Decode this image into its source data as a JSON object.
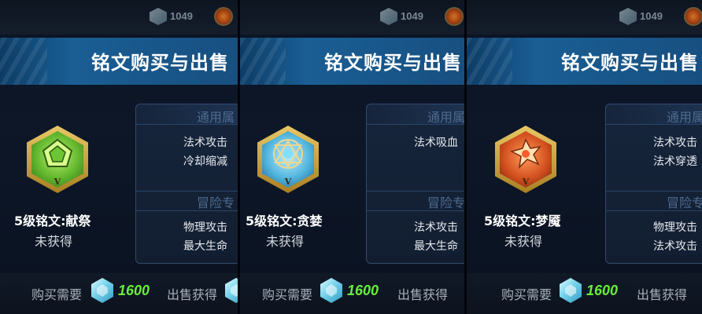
{
  "colors": {
    "banner": "#1a5e94",
    "price": "#67ee3a",
    "section_title": "#4d6b90"
  },
  "panels": [
    {
      "coin_count": "1049",
      "title": "铭文购买与出售",
      "rune_name": "5级铭文:献祭",
      "rune_level": "V",
      "status": "未获得",
      "section1": "通用属",
      "section1_attrs": [
        "法术攻击",
        "冷却缩减"
      ],
      "section2": "冒险专",
      "section2_attrs": [
        "物理攻击",
        "最大生命"
      ],
      "buy_label": "购买需要",
      "price": "1600",
      "sell_label": "出售获得",
      "icon": "green-rune-icon"
    },
    {
      "coin_count": "1049",
      "title": "铭文购买与出售",
      "rune_name": "5级铭文:贪婪",
      "rune_level": "V",
      "status": "未获得",
      "section1": "通用属",
      "section1_attrs": [
        "法术吸血"
      ],
      "section2": "冒险专",
      "section2_attrs": [
        "法术攻击",
        "最大生命"
      ],
      "buy_label": "购买需要",
      "price": "1600",
      "sell_label": "出售获得",
      "icon": "blue-rune-icon"
    },
    {
      "coin_count": "1049",
      "title": "铭文购买与出售",
      "rune_name": "5级铭文:梦魇",
      "rune_level": "V",
      "status": "未获得",
      "section1": "通用属",
      "section1_attrs": [
        "法术攻击",
        "法术穿透"
      ],
      "section2": "冒险专",
      "section2_attrs": [
        "物理攻击",
        "法术攻击"
      ],
      "buy_label": "购买需要",
      "price": "1600",
      "sell_label": "出售获得",
      "icon": "red-rune-icon"
    }
  ]
}
